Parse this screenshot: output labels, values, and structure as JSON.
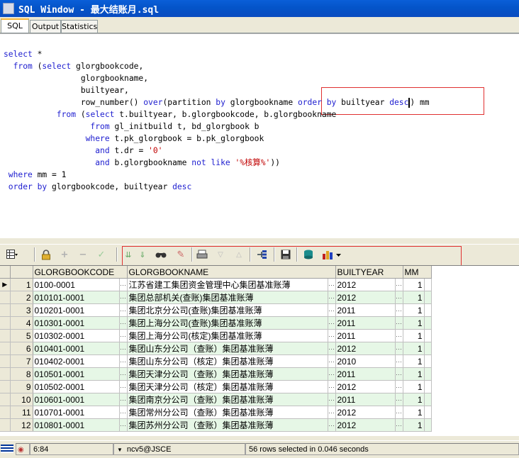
{
  "window": {
    "title": "SQL Window - 最大结账月.sql"
  },
  "tabs": [
    {
      "label": "SQL",
      "active": true
    },
    {
      "label": "Output",
      "active": false
    },
    {
      "label": "Statistics",
      "active": false
    }
  ],
  "editor": {
    "lines": [
      [
        [
          "kw",
          "select"
        ],
        [
          "id",
          " *"
        ]
      ],
      [
        [
          "kw",
          "  from"
        ],
        [
          "id",
          " ("
        ],
        [
          "kw",
          "select"
        ],
        [
          "id",
          " glorgbookcode,"
        ]
      ],
      [
        [
          "id",
          "                glorgbookname,"
        ]
      ],
      [
        [
          "id",
          "                builtyear,"
        ]
      ],
      [
        [
          "id",
          "                row_number() "
        ],
        [
          "kw",
          "over"
        ],
        [
          "id",
          "(partition "
        ],
        [
          "kw",
          "by"
        ],
        [
          "id",
          " glorgbookname "
        ],
        [
          "kw",
          "order by"
        ],
        [
          "id",
          " builtyear "
        ],
        [
          "kw",
          "desc"
        ],
        [
          "caret",
          ""
        ],
        [
          "id",
          ") mm"
        ]
      ],
      [
        [
          "kw",
          "           from"
        ],
        [
          "id",
          " ("
        ],
        [
          "kw",
          "select"
        ],
        [
          "id",
          " t.builtyear, b.glorgbookcode, b.glorgbookname"
        ]
      ],
      [
        [
          "kw",
          "                  from"
        ],
        [
          "id",
          " gl_initbuild t, bd_glorgbook b"
        ]
      ],
      [
        [
          "kw",
          "                 where"
        ],
        [
          "id",
          " t.pk_glorgbook = b.pk_glorgbook"
        ]
      ],
      [
        [
          "kw",
          "                   and"
        ],
        [
          "id",
          " t.dr = "
        ],
        [
          "str",
          "'0'"
        ]
      ],
      [
        [
          "kw",
          "                   and"
        ],
        [
          "id",
          " b.glorgbookname "
        ],
        [
          "kw",
          "not like"
        ],
        [
          "id",
          " "
        ],
        [
          "str",
          "'%核算%'"
        ],
        [
          "id",
          "))"
        ]
      ],
      [
        [
          "kw",
          " where"
        ],
        [
          "id",
          " mm = 1"
        ]
      ],
      [
        [
          "kw",
          " order by"
        ],
        [
          "id",
          " glorgbookcode, builtyear "
        ],
        [
          "kw",
          "desc"
        ]
      ]
    ]
  },
  "results": {
    "columns": [
      "GLORGBOOKCODE",
      "GLORGBOOKNAME",
      "BUILTYEAR",
      "MM"
    ],
    "rows": [
      [
        "1",
        "0100-0001",
        "江苏省建工集团资金管理中心集团基准账薄",
        "2012",
        "1"
      ],
      [
        "2",
        "010101-0001",
        "集团总部机关(查账)集团基准账薄",
        "2012",
        "1"
      ],
      [
        "3",
        "010201-0001",
        "集团北京分公司(查账)集团基准账薄",
        "2011",
        "1"
      ],
      [
        "4",
        "010301-0001",
        "集团上海分公司(查账)集团基准账薄",
        "2011",
        "1"
      ],
      [
        "5",
        "010302-0001",
        "集团上海分公司(核定)集团基准账薄",
        "2011",
        "1"
      ],
      [
        "6",
        "010401-0001",
        "集团山东分公司（查账）集团基准账薄",
        "2012",
        "1"
      ],
      [
        "7",
        "010402-0001",
        "集团山东分公司（核定）集团基准账薄",
        "2010",
        "1"
      ],
      [
        "8",
        "010501-0001",
        "集团天津分公司（查账）集团基准账薄",
        "2011",
        "1"
      ],
      [
        "9",
        "010502-0001",
        "集团天津分公司（核定）集团基准账薄",
        "2012",
        "1"
      ],
      [
        "10",
        "010601-0001",
        "集团南京分公司（查账）集团基准账薄",
        "2011",
        "1"
      ],
      [
        "11",
        "010701-0001",
        "集团常州分公司（查账）集团基准账薄",
        "2012",
        "1"
      ],
      [
        "12",
        "010801-0001",
        "集团苏州分公司（查账）集团基准账薄",
        "2012",
        "1"
      ]
    ],
    "current_row_indicator": "▶",
    "cell_button": "···"
  },
  "status": {
    "position": "6:84",
    "connection": "ncv5@JSCE",
    "message": "56 rows selected in 0.046 seconds"
  },
  "colors": {
    "keyword": "#2020d0",
    "string": "#c00000",
    "alt_row": "#e6f7e6",
    "highlight_box": "#e03030"
  },
  "toolbar_icons": [
    "grid-menu-icon",
    "lock-icon",
    "add-row-icon",
    "delete-row-icon",
    "post-icon",
    "fetch-next-icon",
    "fetch-last-icon",
    "find-icon",
    "clear-icon",
    "print-icon",
    "sort-desc-icon",
    "sort-asc-icon",
    "query-by-example-icon",
    "save-icon",
    "export-icon",
    "chart-icon"
  ]
}
